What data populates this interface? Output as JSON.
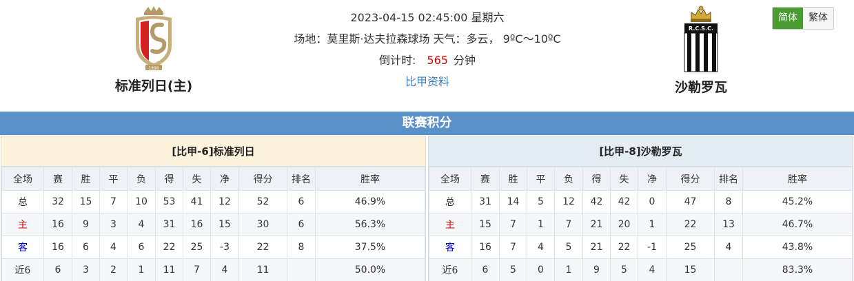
{
  "match": {
    "datetime": "2023-04-15 02:45:00 星期六",
    "venue_line": "场地：莫里斯·达夫拉森球场 天气：多云，  9ºC～10ºC",
    "countdown_label": "倒计时:",
    "countdown_value": "565",
    "countdown_unit": "分钟",
    "league_link": "比甲资料"
  },
  "home_team": {
    "name": "标准列日(主)",
    "logo_year": "1898",
    "logo_icon": "standard-liege-crest"
  },
  "away_team": {
    "name": "沙勒罗瓦",
    "logo_text": "R.C.S.C.",
    "logo_icon": "charleroi-crest"
  },
  "lang": {
    "simplified": "简体",
    "traditional": "繁体"
  },
  "section_title": "联赛积分",
  "columns": [
    "全场",
    "赛",
    "胜",
    "平",
    "负",
    "得",
    "失",
    "净",
    "得分",
    "排名",
    "胜率"
  ],
  "home_panel": {
    "title": "[比甲-6]标准列日",
    "rows": [
      {
        "label": "总",
        "kind": "total",
        "cells": [
          "32",
          "15",
          "7",
          "10",
          "53",
          "41",
          "12",
          "52",
          "6",
          "46.9%"
        ]
      },
      {
        "label": "主",
        "kind": "home",
        "cells": [
          "16",
          "9",
          "3",
          "4",
          "31",
          "16",
          "15",
          "30",
          "6",
          "56.3%"
        ]
      },
      {
        "label": "客",
        "kind": "away",
        "cells": [
          "16",
          "6",
          "4",
          "6",
          "22",
          "25",
          "-3",
          "22",
          "8",
          "37.5%"
        ]
      },
      {
        "label": "近6",
        "kind": "recent",
        "cells": [
          "6",
          "3",
          "2",
          "1",
          "11",
          "7",
          "4",
          "11",
          "",
          "50.0%"
        ]
      }
    ]
  },
  "away_panel": {
    "title": "[比甲-8]沙勒罗瓦",
    "rows": [
      {
        "label": "总",
        "kind": "total",
        "cells": [
          "31",
          "14",
          "5",
          "12",
          "42",
          "42",
          "0",
          "47",
          "8",
          "45.2%"
        ]
      },
      {
        "label": "主",
        "kind": "home",
        "cells": [
          "15",
          "7",
          "1",
          "7",
          "21",
          "20",
          "1",
          "22",
          "13",
          "46.7%"
        ]
      },
      {
        "label": "客",
        "kind": "away",
        "cells": [
          "16",
          "7",
          "4",
          "5",
          "21",
          "22",
          "-1",
          "25",
          "4",
          "43.8%"
        ]
      },
      {
        "label": "近6",
        "kind": "recent",
        "cells": [
          "6",
          "5",
          "0",
          "1",
          "9",
          "5",
          "4",
          "15",
          "",
          "83.3%"
        ]
      }
    ]
  }
}
